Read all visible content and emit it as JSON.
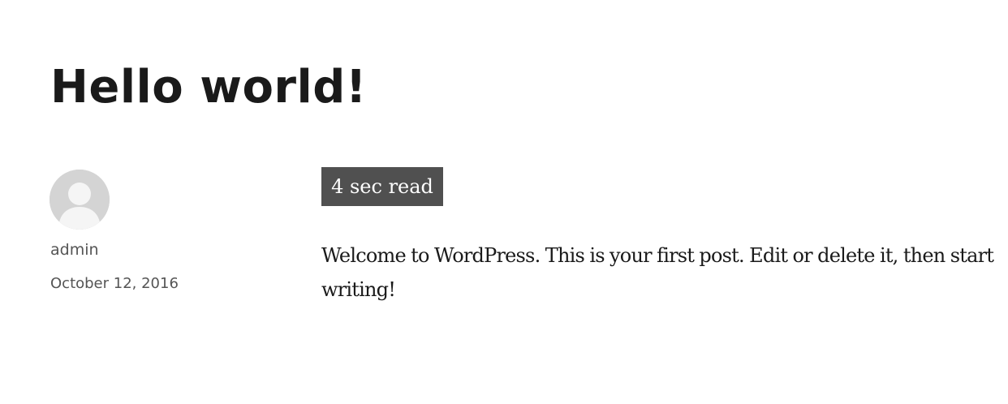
{
  "post": {
    "title": "Hello world!",
    "author": "admin",
    "date": "October 12, 2016",
    "read_time": "4 sec read",
    "content": "Welcome to WordPress. This is your first post. Edit or delete it, then start writing!"
  },
  "icons": {
    "avatar": "default-avatar-icon"
  },
  "colors": {
    "badge_background": "#505050",
    "meta_text": "#555555",
    "title_text": "#1a1a1a",
    "avatar_background": "#d4d4d4"
  }
}
